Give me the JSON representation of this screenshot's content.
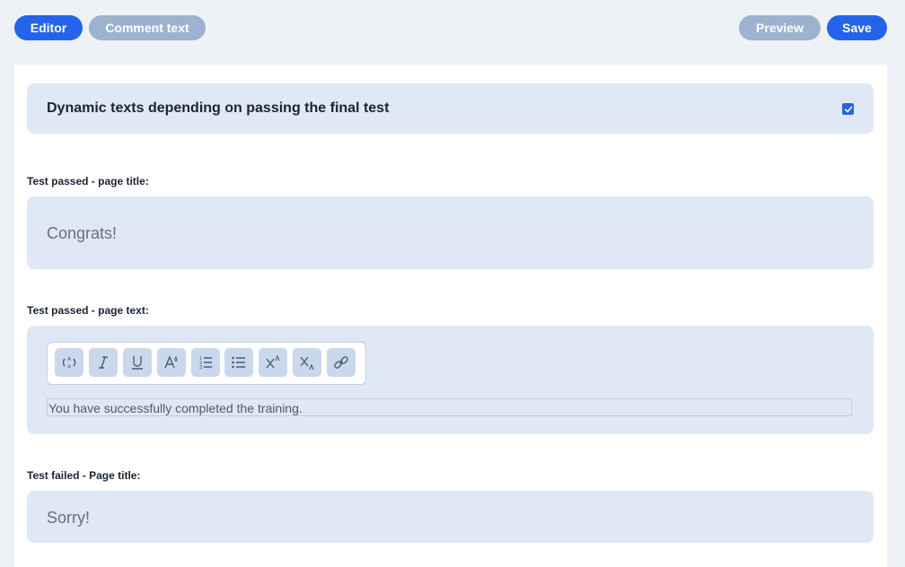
{
  "tabs": {
    "editor": "Editor",
    "comment": "Comment text"
  },
  "actions": {
    "preview": "Preview",
    "save": "Save"
  },
  "dynamic_toggle": {
    "label": "Dynamic texts depending on passing the final test",
    "checked": true
  },
  "passed_title": {
    "label": "Test passed - page title:",
    "value": "Congrats!"
  },
  "passed_text": {
    "label": "Test passed - page text:",
    "toolbar_icons": [
      "clear-format-icon",
      "italic-icon",
      "underline-icon",
      "font-color-icon",
      "ordered-list-icon",
      "unordered-list-icon",
      "superscript-icon",
      "subscript-icon",
      "link-icon"
    ],
    "value": "You have successfully completed the training."
  },
  "failed_title": {
    "label": "Test failed - Page title:",
    "value": "Sorry!"
  },
  "colors": {
    "accent": "#2563eb",
    "muted_pill": "#9cb2cf",
    "field_bg": "#dfe8f5",
    "page_bg": "#eef2f7"
  }
}
